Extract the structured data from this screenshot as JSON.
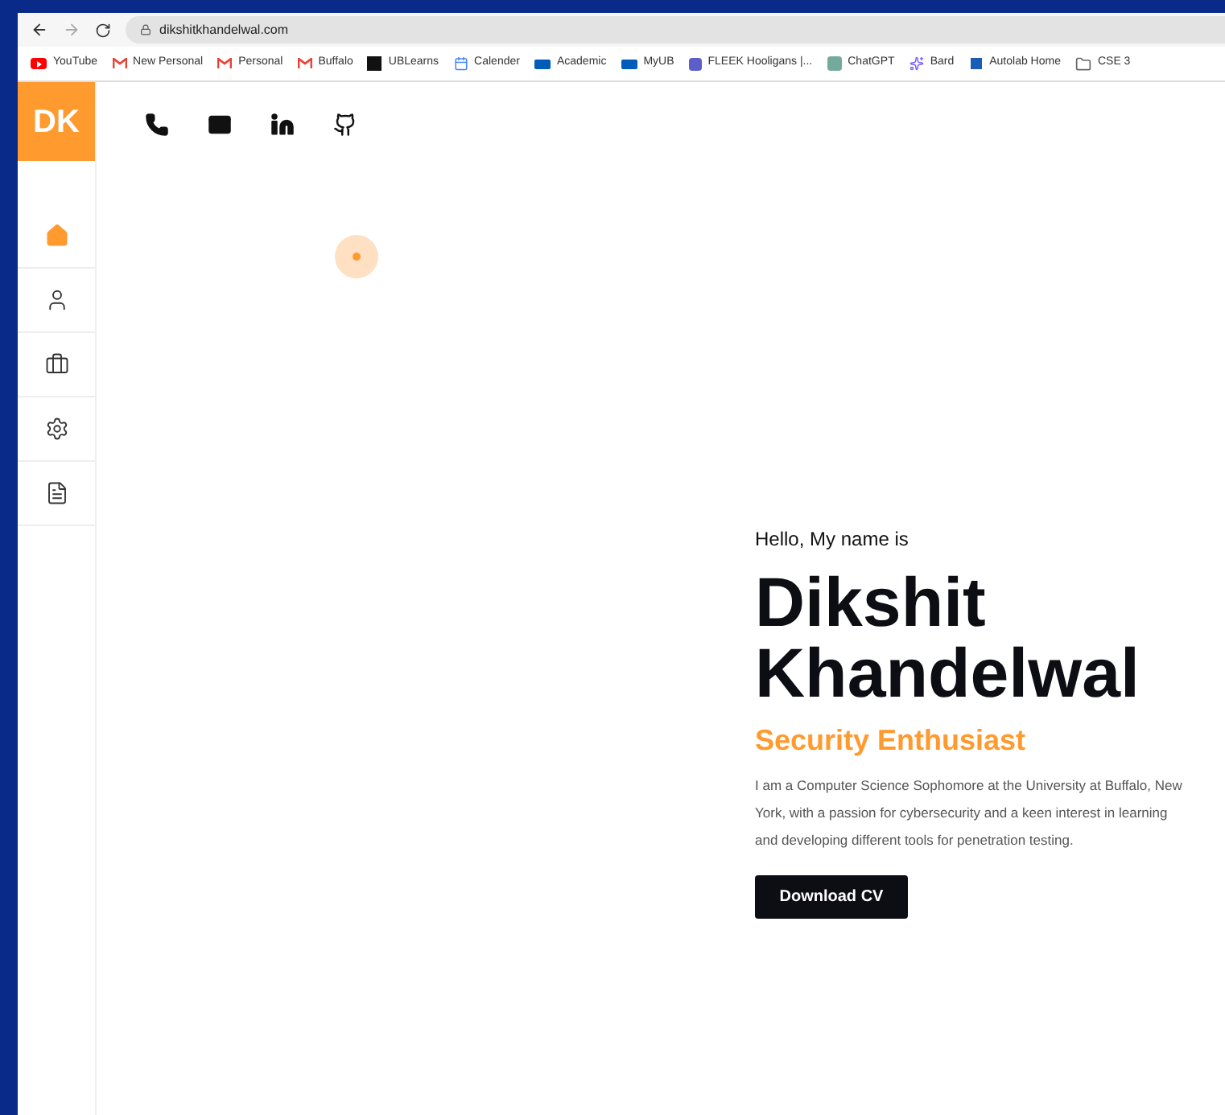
{
  "browser": {
    "url": "dikshitkhandelwal.com",
    "bookmarks": [
      {
        "label": "YouTube",
        "kind": "youtube"
      },
      {
        "label": "New Personal",
        "kind": "gmail"
      },
      {
        "label": "Personal",
        "kind": "gmail"
      },
      {
        "label": "Buffalo",
        "kind": "gmail"
      },
      {
        "label": "UBLearns",
        "kind": "ublearns"
      },
      {
        "label": "Calender",
        "kind": "calendar"
      },
      {
        "label": "Academic",
        "kind": "ub"
      },
      {
        "label": "MyUB",
        "kind": "ub"
      },
      {
        "label": "FLEEK Hooligans |...",
        "kind": "teams"
      },
      {
        "label": "ChatGPT",
        "kind": "chatgpt"
      },
      {
        "label": "Bard",
        "kind": "bard"
      },
      {
        "label": "Autolab Home",
        "kind": "autolab"
      },
      {
        "label": "CSE 3",
        "kind": "folder"
      }
    ]
  },
  "logo": "DK",
  "social": [
    {
      "kind": "phone"
    },
    {
      "kind": "mail"
    },
    {
      "kind": "linkedin"
    },
    {
      "kind": "github"
    }
  ],
  "nav": [
    {
      "kind": "home",
      "selected": true
    },
    {
      "kind": "user",
      "selected": false
    },
    {
      "kind": "briefcase",
      "selected": false
    },
    {
      "kind": "settings",
      "selected": false
    },
    {
      "kind": "document",
      "selected": false
    }
  ],
  "hero": {
    "greeting": "Hello, My name is",
    "name_lines": [
      "Dikshit",
      "Khandelwal"
    ],
    "role": "Security Enthusiast",
    "bio": "I am a Computer Science Sophomore at the University at Buffalo, New York, with a passion for cybersecurity and a keen interest in learning and developing different tools for penetration testing.",
    "button": "Download CV"
  }
}
